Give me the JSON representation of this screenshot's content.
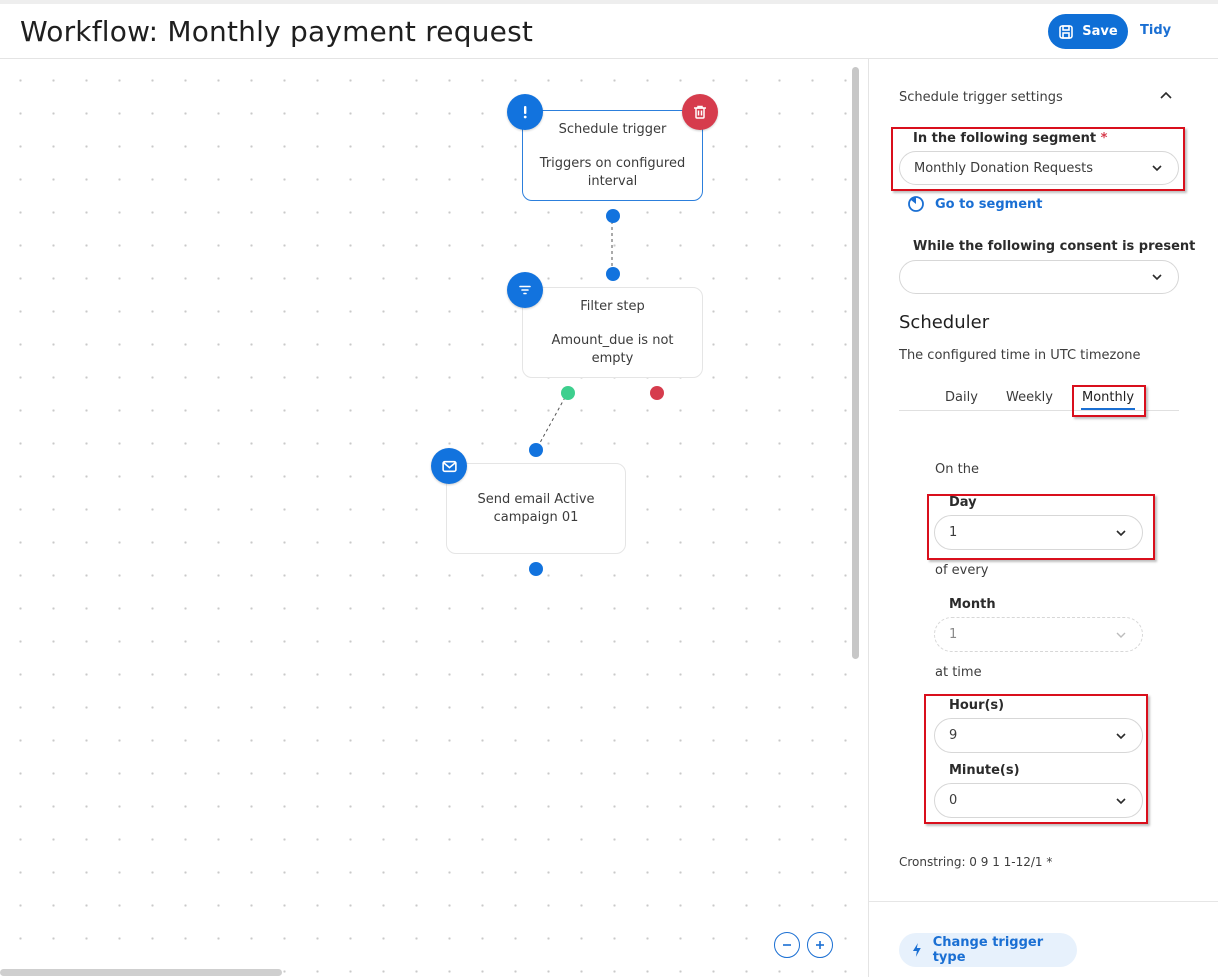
{
  "header": {
    "title": "Workflow: Monthly payment request",
    "save_label": "Save",
    "tidy_label": "Tidy"
  },
  "canvas": {
    "nodes": [
      {
        "title": "Schedule trigger",
        "description": "Triggers on configured interval",
        "icon": "exclamation-icon"
      },
      {
        "title": "Filter step",
        "description": "Amount_due is not empty",
        "icon": "filter-icon"
      },
      {
        "title": "Send email Active campaign 01",
        "icon": "mail-icon"
      }
    ],
    "delete_icon": "trash-icon",
    "zoom_out_icon": "minus-icon",
    "zoom_in_icon": "plus-icon"
  },
  "panel": {
    "section_title": "Schedule trigger settings",
    "segment_label": "In the following segment",
    "segment_required_mark": "*",
    "segment_value": "Monthly Donation Requests",
    "go_to_segment": "Go to segment",
    "consent_label": "While the following consent is present",
    "consent_value": "",
    "scheduler_title": "Scheduler",
    "scheduler_note": "The configured time in UTC timezone",
    "tabs": [
      "Daily",
      "Weekly",
      "Monthly"
    ],
    "active_tab": "Monthly",
    "on_the": "On the",
    "day_label": "Day",
    "day_value": "1",
    "of_every": "of every",
    "month_label": "Month",
    "month_value": "1",
    "at_time": "at time",
    "hours_label": "Hour(s)",
    "hours_value": "9",
    "minutes_label": "Minute(s)",
    "minutes_value": "0",
    "cronstring": "Cronstring: 0 9 1 1-12/1 *",
    "change_trigger_label": "Change trigger type"
  },
  "colors": {
    "primary": "#1273de",
    "danger": "#d63c4d",
    "success": "#3ecf8e",
    "highlight": "#d90f1c"
  }
}
